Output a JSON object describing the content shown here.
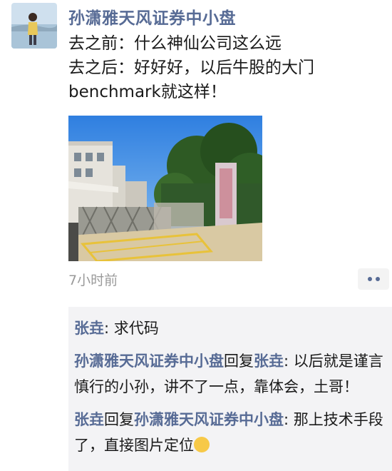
{
  "post": {
    "author": "孙潇雅天风证券中小盘",
    "lines": [
      "去之前：什么神仙公司这么远",
      "去之后：好好好，以后牛股的大门",
      "benchmark就这样！"
    ],
    "time": "7小时前"
  },
  "comments": [
    {
      "user": "张垚",
      "sep": ": ",
      "text": "求代码"
    },
    {
      "user": "孙潇雅天风证券中小盘",
      "reply_word": "回复",
      "target": "张垚",
      "sep": ": ",
      "text": "以后就是谨言慎行的小孙，讲不了一点，靠体会，土哥！"
    },
    {
      "user": "张垚",
      "reply_word": "回复",
      "target": "孙潇雅天风证券中小盘",
      "sep": ": ",
      "text": "那上技术手段了，直接图片定位"
    }
  ],
  "icons": {
    "more": "more-dots-icon",
    "emoji": "smirk-emoji-icon"
  }
}
